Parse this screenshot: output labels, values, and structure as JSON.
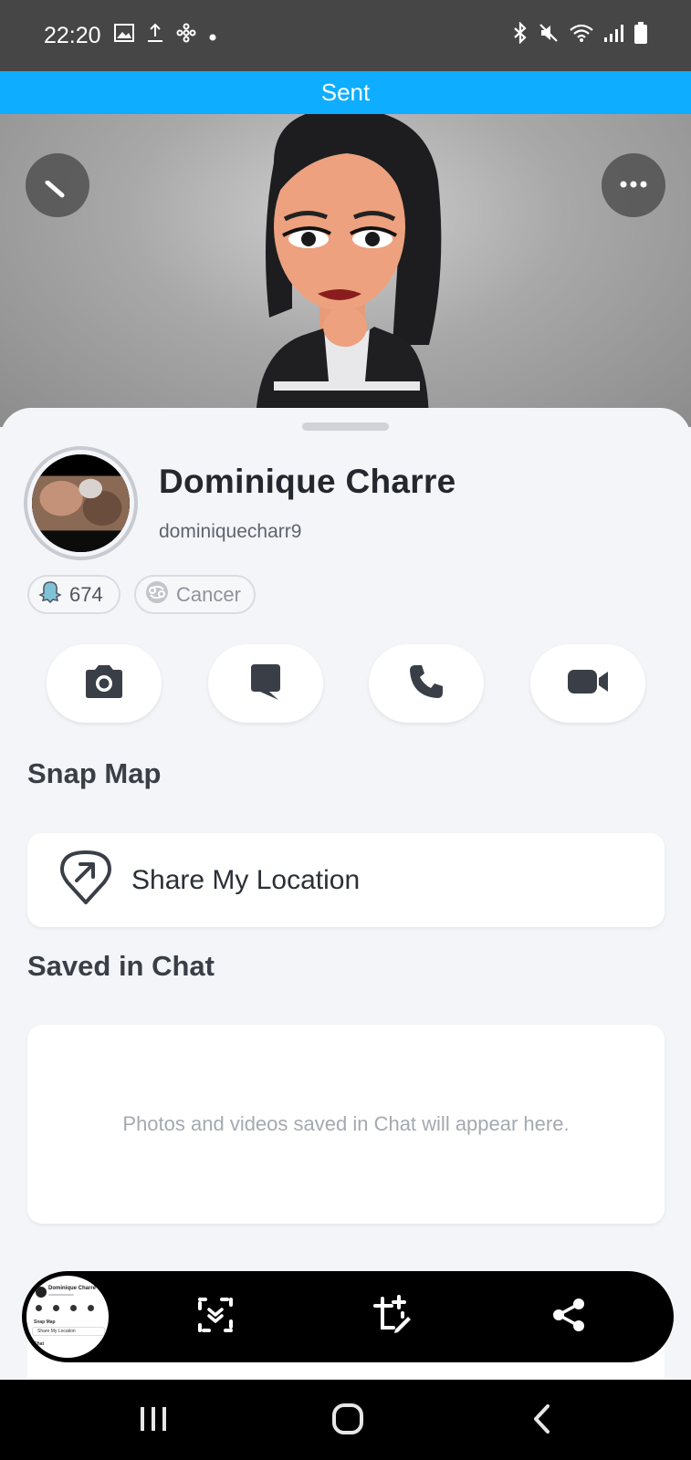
{
  "status_bar": {
    "time": "22:20",
    "left_icons": [
      "gallery-icon",
      "upload-icon",
      "pinwheel-icon",
      "dot-icon"
    ],
    "right_icons": [
      "bluetooth-icon",
      "mute-icon",
      "wifi-icon",
      "signal-icon",
      "battery-icon"
    ]
  },
  "banner": {
    "text": "Sent"
  },
  "hero": {
    "left_button": "back-chevron",
    "right_button": "more-options"
  },
  "profile": {
    "name": "Dominique Charre",
    "username": "dominiquecharr9",
    "snap_score": "674",
    "zodiac": "Cancer"
  },
  "actions": [
    {
      "id": "camera",
      "icon": "camera-icon"
    },
    {
      "id": "chat",
      "icon": "chat-icon"
    },
    {
      "id": "call",
      "icon": "phone-icon"
    },
    {
      "id": "video",
      "icon": "video-icon"
    }
  ],
  "snap_map": {
    "title": "Snap Map",
    "share_location_label": "Share My Location"
  },
  "saved_in_chat": {
    "title": "Saved in Chat",
    "empty_text": "Photos and videos saved in Chat will appear here."
  },
  "screenshot_toolbar": {
    "thumbnail": {
      "name": "Dominique Charre",
      "section": "Snap Map",
      "location": "Share My Location",
      "chat": "Chat"
    },
    "icons": [
      "scan-icon",
      "crop-edit-icon",
      "share-icon"
    ]
  },
  "nav_bar": {
    "icons": [
      "recents-icon",
      "home-icon",
      "back-icon"
    ]
  },
  "colors": {
    "banner": "#0eadff",
    "status_bar": "#464646",
    "sheet_bg": "#f4f5f8",
    "icon_dark": "#3a3f47"
  }
}
